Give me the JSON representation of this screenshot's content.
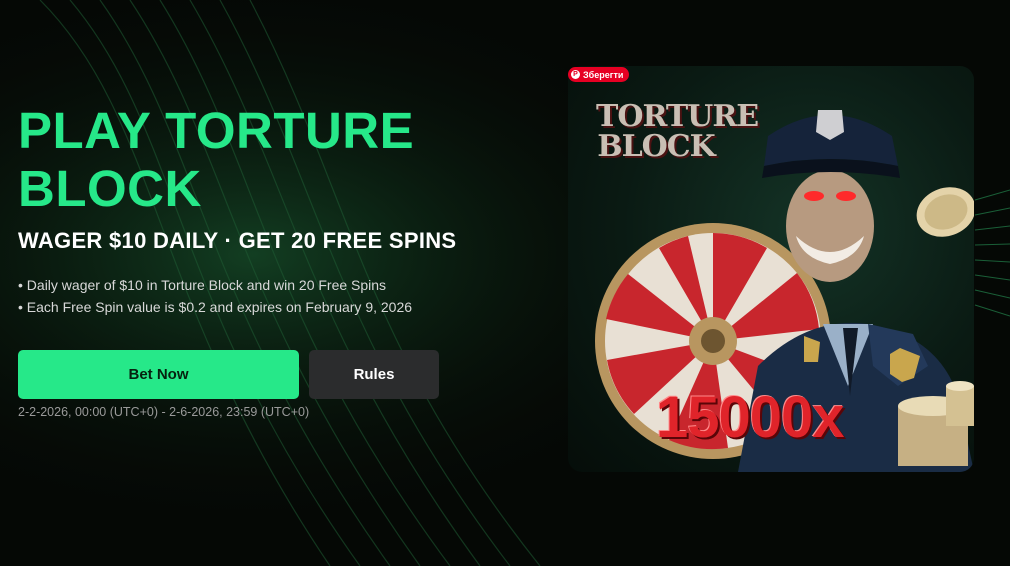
{
  "promo": {
    "title": "PLAY TORTURE BLOCK",
    "subtitle": "WAGER $10 DAILY · GET 20 FREE SPINS",
    "bullets": [
      "Daily wager of $10 in Torture Block and win 20 Free Spins",
      "Each Free Spin value is $0.2 and expires on February 9, 2026"
    ],
    "bet_label": "Bet Now",
    "rules_label": "Rules",
    "dates": "2-2-2026, 00:00 (UTC+0) - 2-6-2026, 23:59 (UTC+0)"
  },
  "card": {
    "save_label": "Зберегти",
    "game_logo": "TORTURE BLOCK",
    "multiplier": "15000x"
  },
  "colors": {
    "accent": "#26e889",
    "background": "#050805",
    "secondary_button": "#2b2c2d",
    "multiplier_red": "#e0242a",
    "save_badge": "#e60023"
  }
}
